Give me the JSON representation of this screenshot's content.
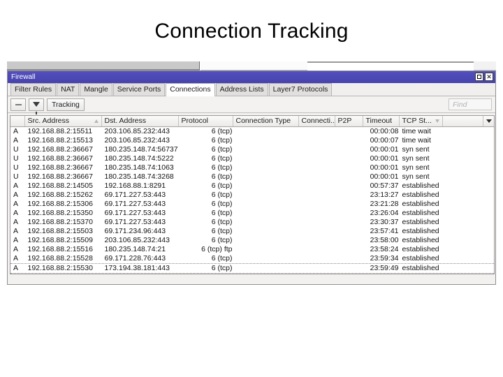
{
  "slide": {
    "title": "Connection Tracking"
  },
  "window": {
    "title": "Firewall",
    "buttons": {
      "maximize": "maximize-button",
      "close": "✕"
    }
  },
  "tabs": [
    {
      "label": "Filter Rules",
      "active": false
    },
    {
      "label": "NAT",
      "active": false
    },
    {
      "label": "Mangle",
      "active": false
    },
    {
      "label": "Service Ports",
      "active": false
    },
    {
      "label": "Connections",
      "active": true
    },
    {
      "label": "Address Lists",
      "active": false
    },
    {
      "label": "Layer7 Protocols",
      "active": false
    }
  ],
  "toolbar": {
    "remove_label": "",
    "filter_label": "",
    "tracking_label": "Tracking",
    "find_placeholder": "Find"
  },
  "table": {
    "columns": [
      {
        "key": "flag",
        "label": "",
        "sort": "none"
      },
      {
        "key": "src",
        "label": "Src. Address",
        "sort": "asc"
      },
      {
        "key": "dst",
        "label": "Dst. Address",
        "sort": "none"
      },
      {
        "key": "proto",
        "label": "Protocol",
        "sort": "none"
      },
      {
        "key": "ctype",
        "label": "Connection Type",
        "sort": "none"
      },
      {
        "key": "ctrk",
        "label": "Connecti...",
        "sort": "none"
      },
      {
        "key": "p2p",
        "label": "P2P",
        "sort": "none"
      },
      {
        "key": "timeout",
        "label": "Timeout",
        "sort": "none"
      },
      {
        "key": "tcp",
        "label": "TCP St...",
        "sort": "desc"
      },
      {
        "key": "pad",
        "label": "",
        "sort": "none"
      },
      {
        "key": "drop",
        "label": "",
        "sort": "none"
      }
    ],
    "rows": [
      {
        "flag": "A",
        "src": "192.168.88.2:15511",
        "dst": "203.106.85.232:443",
        "proto": "6 (tcp)",
        "ctype": "",
        "ctrk": "",
        "p2p": "",
        "timeout": "00:00:08",
        "tcp": "time wait"
      },
      {
        "flag": "A",
        "src": "192.168.88.2:15513",
        "dst": "203.106.85.232:443",
        "proto": "6 (tcp)",
        "ctype": "",
        "ctrk": "",
        "p2p": "",
        "timeout": "00:00:07",
        "tcp": "time wait"
      },
      {
        "flag": "U",
        "src": "192.168.88.2:36667",
        "dst": "180.235.148.74:56737",
        "proto": "6 (tcp)",
        "ctype": "",
        "ctrk": "",
        "p2p": "",
        "timeout": "00:00:01",
        "tcp": "syn sent"
      },
      {
        "flag": "U",
        "src": "192.168.88.2:36667",
        "dst": "180.235.148.74:5222",
        "proto": "6 (tcp)",
        "ctype": "",
        "ctrk": "",
        "p2p": "",
        "timeout": "00:00:01",
        "tcp": "syn sent"
      },
      {
        "flag": "U",
        "src": "192.168.88.2:36667",
        "dst": "180.235.148.74:1063",
        "proto": "6 (tcp)",
        "ctype": "",
        "ctrk": "",
        "p2p": "",
        "timeout": "00:00:01",
        "tcp": "syn sent"
      },
      {
        "flag": "U",
        "src": "192.168.88.2:36667",
        "dst": "180.235.148.74:3268",
        "proto": "6 (tcp)",
        "ctype": "",
        "ctrk": "",
        "p2p": "",
        "timeout": "00:00:01",
        "tcp": "syn sent"
      },
      {
        "flag": "A",
        "src": "192.168.88.2:14505",
        "dst": "192.168.88.1:8291",
        "proto": "6 (tcp)",
        "ctype": "",
        "ctrk": "",
        "p2p": "",
        "timeout": "00:57:37",
        "tcp": "established"
      },
      {
        "flag": "A",
        "src": "192.168.88.2:15262",
        "dst": "69.171.227.53:443",
        "proto": "6 (tcp)",
        "ctype": "",
        "ctrk": "",
        "p2p": "",
        "timeout": "23:13:27",
        "tcp": "established"
      },
      {
        "flag": "A",
        "src": "192.168.88.2:15306",
        "dst": "69.171.227.53:443",
        "proto": "6 (tcp)",
        "ctype": "",
        "ctrk": "",
        "p2p": "",
        "timeout": "23:21:28",
        "tcp": "established"
      },
      {
        "flag": "A",
        "src": "192.168.88.2:15350",
        "dst": "69.171.227.53:443",
        "proto": "6 (tcp)",
        "ctype": "",
        "ctrk": "",
        "p2p": "",
        "timeout": "23:26:04",
        "tcp": "established"
      },
      {
        "flag": "A",
        "src": "192.168.88.2:15370",
        "dst": "69.171.227.53:443",
        "proto": "6 (tcp)",
        "ctype": "",
        "ctrk": "",
        "p2p": "",
        "timeout": "23:30:37",
        "tcp": "established"
      },
      {
        "flag": "A",
        "src": "192.168.88.2:15503",
        "dst": "69.171.234.96:443",
        "proto": "6 (tcp)",
        "ctype": "",
        "ctrk": "",
        "p2p": "",
        "timeout": "23:57:41",
        "tcp": "established"
      },
      {
        "flag": "A",
        "src": "192.168.88.2:15509",
        "dst": "203.106.85.232:443",
        "proto": "6 (tcp)",
        "ctype": "",
        "ctrk": "",
        "p2p": "",
        "timeout": "23:58:00",
        "tcp": "established"
      },
      {
        "flag": "A",
        "src": "192.168.88.2:15516",
        "dst": "180.235.148.74:21",
        "proto": "6 (tcp) ftp",
        "ctype": "",
        "ctrk": "",
        "p2p": "",
        "timeout": "23:58:24",
        "tcp": "established"
      },
      {
        "flag": "A",
        "src": "192.168.88.2:15528",
        "dst": "69.171.228.76:443",
        "proto": "6 (tcp)",
        "ctype": "",
        "ctrk": "",
        "p2p": "",
        "timeout": "23:59:34",
        "tcp": "established"
      },
      {
        "flag": "A",
        "src": "192.168.88.2:15530",
        "dst": "173.194.38.181:443",
        "proto": "6 (tcp)",
        "ctype": "",
        "ctrk": "",
        "p2p": "",
        "timeout": "23:59:49",
        "tcp": "established",
        "focused": true
      }
    ]
  },
  "colors": {
    "titlebar": "#4a47b5",
    "window_bg": "#f2f1f0",
    "grid_bg": "#ffffff",
    "text": "#121212"
  }
}
